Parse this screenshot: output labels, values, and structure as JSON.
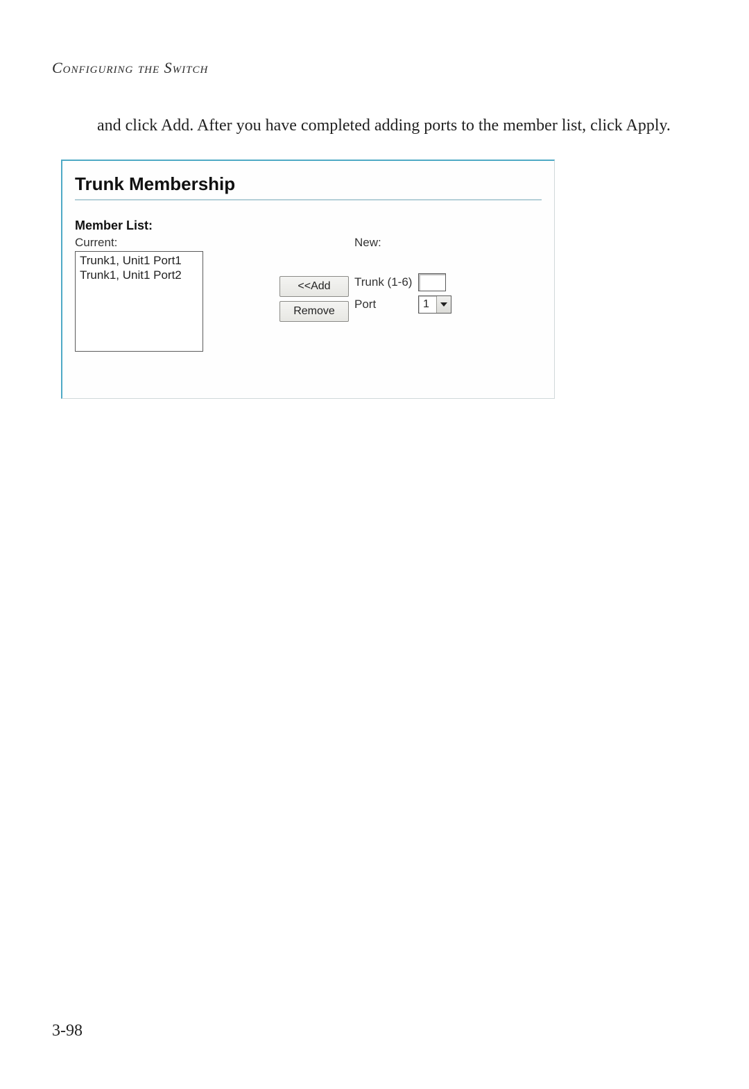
{
  "header": "Configuring the Switch",
  "body_text": "and click Add. After you have completed adding ports to the member list, click Apply.",
  "panel": {
    "title": "Trunk Membership",
    "member_list_label": "Member List:",
    "current_label": "Current:",
    "new_label": "New:",
    "current_items": [
      "Trunk1, Unit1 Port1",
      "Trunk1, Unit1 Port2"
    ],
    "buttons": {
      "add": "<<Add",
      "remove": "Remove"
    },
    "trunk_field_label": "Trunk (1-6)",
    "trunk_field_value": "",
    "port_field_label": "Port",
    "port_select_value": "1"
  },
  "page_number": "3-98"
}
